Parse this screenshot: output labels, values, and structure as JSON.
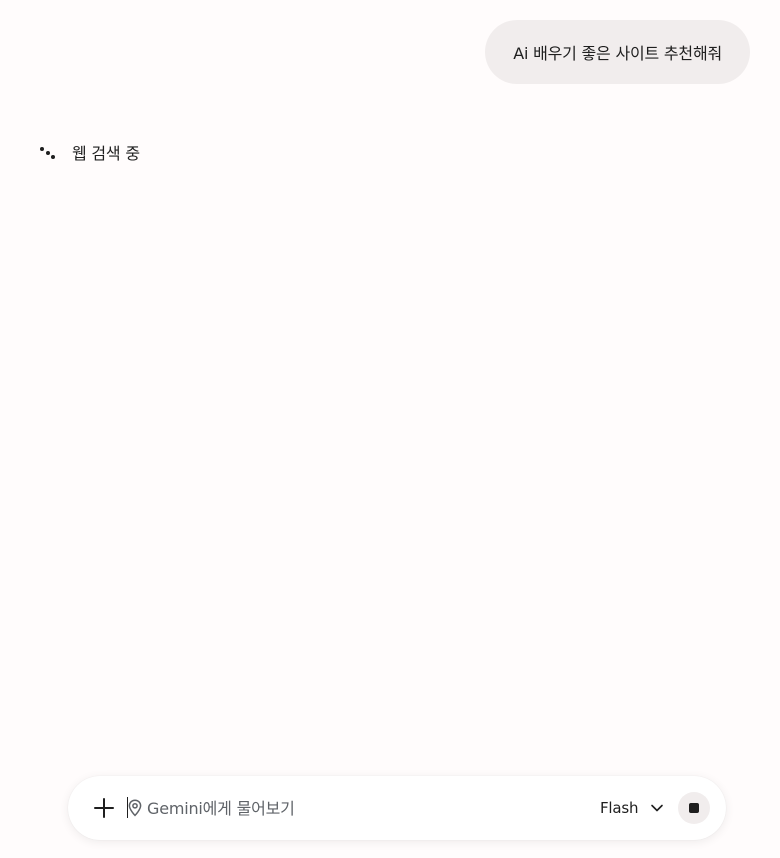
{
  "conversation": {
    "user_message": "Ai 배우기 좋은 사이트 추천해줘",
    "status_text": "웹 검색 중",
    "status_icon": "thinking-dots-icon"
  },
  "composer": {
    "add_icon": "plus-icon",
    "location_icon": "location-pin-icon",
    "placeholder": "Gemini에게 물어보기",
    "value": "",
    "model_label": "Flash",
    "model_icon": "chevron-down-icon",
    "stop_icon": "stop-icon"
  },
  "colors": {
    "background": "#fffcfc",
    "bubble": "#f1eded",
    "text": "#1f1f1f",
    "placeholder": "#5f6368"
  }
}
